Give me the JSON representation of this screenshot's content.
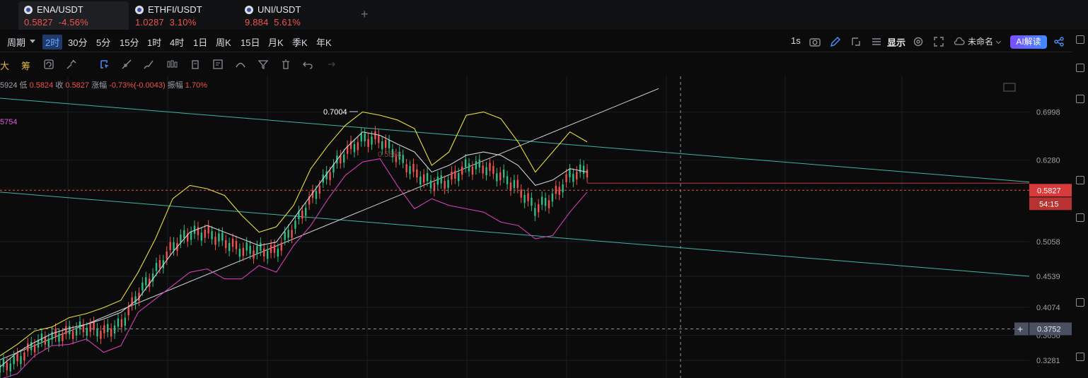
{
  "tabs": [
    {
      "symbol": "ENA/USDT",
      "price": "0.5827",
      "change": "-4.56%"
    },
    {
      "symbol": "ETHFI/USDT",
      "price": "1.0287",
      "change": "3.10%"
    },
    {
      "symbol": "UNI/USDT",
      "price": "9.884",
      "change": "5.61%"
    }
  ],
  "add_tab": "+",
  "toolbar": {
    "period_label": "周期",
    "periods": [
      "2时",
      "30分",
      "5分",
      "15分",
      "1时",
      "4时",
      "1日",
      "周K",
      "15日",
      "月K",
      "季K",
      "年K"
    ],
    "selected_period": "2时",
    "refresh": "1s",
    "display_label": "显示",
    "layout_name": "未命名",
    "ai_label": "AI解读"
  },
  "toolbar2": {
    "big": "大",
    "chips": "筹"
  },
  "ohlc_info": {
    "open_partial": "5924",
    "low_label": "低",
    "low": "0.5824",
    "close_label": "收",
    "close": "0.5827",
    "change_label": "涨幅",
    "change": "-0.73%(-0.0043)",
    "amp_label": "振幅",
    "amp": "1.70%"
  },
  "indicator_value": "5754",
  "chart_data": {
    "type": "line",
    "y_ticks": [
      "0.6998",
      "0.6280",
      "0.5058",
      "0.4539",
      "0.4074",
      "0.3656",
      "0.3281"
    ],
    "ylim": [
      0.3281,
      0.7004
    ],
    "current_price": "0.5827",
    "countdown": "54:15",
    "crosshair_price": "0.3752",
    "high_annotation": "0.7004",
    "faint_annotation": "0.5888",
    "series": [
      {
        "color": "#e8e03a",
        "values": [
          0.335,
          0.352,
          0.372,
          0.378,
          0.392,
          0.398,
          0.407,
          0.418,
          0.46,
          0.51,
          0.57,
          0.59,
          0.585,
          0.575,
          0.545,
          0.52,
          0.528,
          0.56,
          0.615,
          0.65,
          0.68,
          0.7,
          0.695,
          0.688,
          0.675,
          0.62,
          0.64,
          0.695,
          0.7,
          0.69,
          0.655,
          0.61,
          0.64,
          0.67,
          0.655
        ]
      },
      {
        "color": "#cfd3d8",
        "values": [
          0.318,
          0.34,
          0.355,
          0.368,
          0.376,
          0.382,
          0.39,
          0.4,
          0.42,
          0.455,
          0.49,
          0.52,
          0.53,
          0.52,
          0.51,
          0.5,
          0.505,
          0.54,
          0.575,
          0.61,
          0.645,
          0.67,
          0.665,
          0.652,
          0.64,
          0.61,
          0.62,
          0.635,
          0.64,
          0.635,
          0.62,
          0.59,
          0.598,
          0.615,
          0.61
        ]
      },
      {
        "color": "#d03fb7",
        "values": [
          0.3,
          0.308,
          0.335,
          0.35,
          0.352,
          0.36,
          0.34,
          0.35,
          0.4,
          0.42,
          0.44,
          0.46,
          0.465,
          0.45,
          0.45,
          0.47,
          0.46,
          0.5,
          0.53,
          0.57,
          0.605,
          0.625,
          0.63,
          0.59,
          0.555,
          0.57,
          0.56,
          0.555,
          0.55,
          0.535,
          0.53,
          0.51,
          0.515,
          0.55,
          0.58
        ]
      }
    ],
    "trendlines": [
      {
        "color": "#3fb5a5",
        "p1": [
          0,
          0.58
        ],
        "p2": [
          1,
          0.454
        ]
      },
      {
        "color": "#3fb5a5",
        "p1": [
          0,
          0.7205
        ],
        "p2": [
          1,
          0.595
        ]
      },
      {
        "color": "#cfd3d8",
        "p1": [
          0,
          0.329
        ],
        "p2": [
          0.64,
          0.735
        ]
      }
    ]
  }
}
